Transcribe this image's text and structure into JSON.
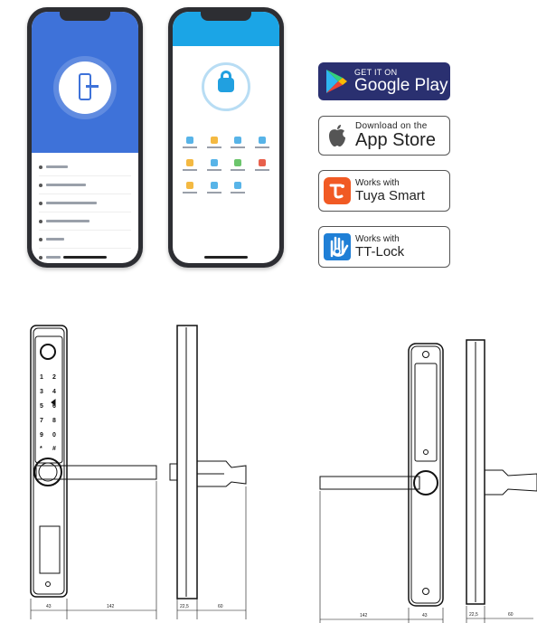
{
  "badges": {
    "google_play": {
      "small": "GET IT ON",
      "big": "Google Play",
      "icon": "google-play-icon",
      "bg": "#2a3070"
    },
    "app_store": {
      "small": "Download on the",
      "big": "App Store",
      "icon": "apple-icon"
    },
    "tuya": {
      "small": "Works with",
      "big": "Tuya Smart",
      "icon": "tuya-icon",
      "color": "#f15a24"
    },
    "ttlock": {
      "small": "Works with",
      "big": "TT-Lock",
      "icon": "ttlock-hand-icon",
      "color": "#1f7fd6"
    }
  },
  "keypad": {
    "keys": [
      "1",
      "2",
      "3",
      "4",
      "5",
      "6",
      "7",
      "8",
      "9",
      "0",
      "*",
      "#"
    ]
  },
  "dimensions": {
    "front_width": "43",
    "handle_length": "142",
    "side_thickness": "22,5",
    "side_projection": "60",
    "back_handle_length": "142",
    "back_width": "43",
    "back_side_thickness": "22,5",
    "back_side_projection": "60"
  },
  "colors": {
    "app_blue": "#3e72d9",
    "tuya_blue": "#1ba5e6",
    "phone_frame": "#2d2e33"
  }
}
